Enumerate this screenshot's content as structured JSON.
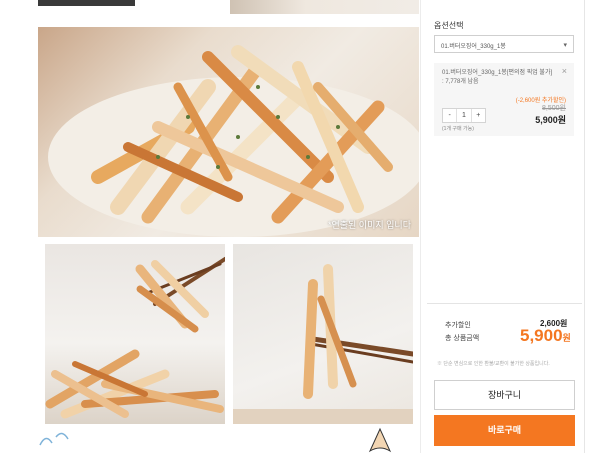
{
  "gallery": {
    "main_caption": "*연출된 이미지 입니다"
  },
  "options": {
    "label": "옵션선택",
    "selected": "01.버터오징어_330g_1봉"
  },
  "item": {
    "name": "01.버터오징어_330g_1봉[편의점 픽업 불가] : 7,778개 남음",
    "close_icon": "×",
    "discount_note": "(-2,600원 추가할인)",
    "quantity": "1",
    "minus": "-",
    "plus": "+",
    "original_price": "8,500원",
    "price": "5,900원",
    "limit_note": "(1개 구매 가능)"
  },
  "summary": {
    "additional_discount_label": "추가할인",
    "additional_discount_value": "2,600원",
    "total_label": "총 상품금액",
    "total_value": "5,900",
    "total_unit": "원",
    "notice": "※ 단순 변심으로 인한 환불/교환이 불가한 상품입니다."
  },
  "buttons": {
    "cart": "장바구니",
    "buy": "바로구매"
  },
  "colors": {
    "accent": "#f47721"
  }
}
